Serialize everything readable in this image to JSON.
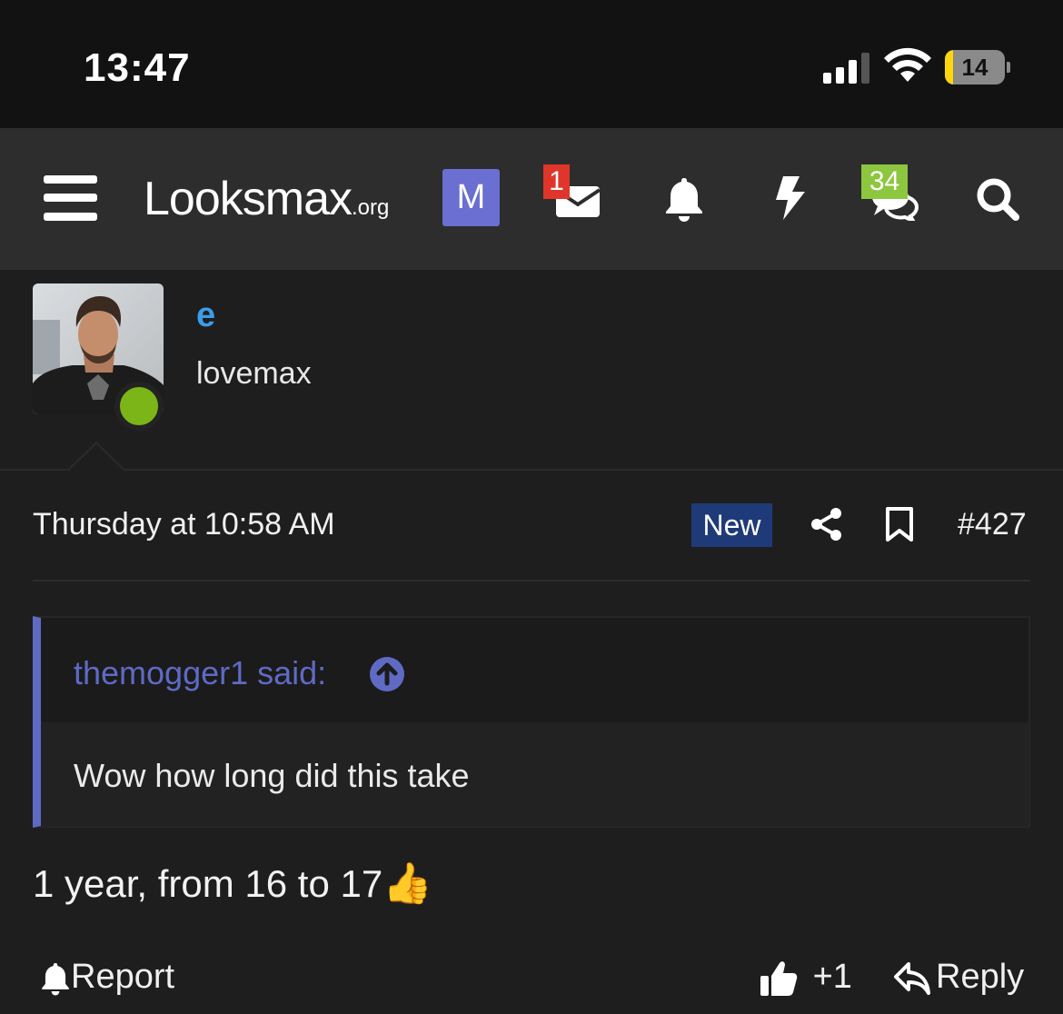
{
  "status_bar": {
    "time": "13:47",
    "battery_level": "14",
    "battery_charging": true,
    "signal_bars": 3,
    "signal_max": 4
  },
  "navbar": {
    "logo_main": "Looksmax",
    "logo_tld": ".org",
    "user_initial": "M",
    "user_badge_color": "#6a6fd1",
    "inbox_count": "1",
    "inbox_badge_color": "#e0352b",
    "chats_count": "34",
    "chats_badge_color": "#8dc63f",
    "icons": [
      "menu-icon",
      "envelope-icon",
      "bell-icon",
      "lightning-icon",
      "chat-bubbles-icon",
      "search-icon"
    ]
  },
  "post": {
    "username": "e",
    "username_color": "#3b9de9",
    "user_title": "lovemax",
    "online": true,
    "date": "Thursday at 10:58 AM",
    "new_label": "New",
    "post_number": "#427",
    "quote": {
      "author_label": "themogger1 said:",
      "text": "Wow how long did this take"
    },
    "body_text": "1 year, from 16 to 17",
    "body_emoji": "👍"
  },
  "actions": {
    "report_label": "Report",
    "like_count": "+1",
    "reply_label": "Reply"
  }
}
